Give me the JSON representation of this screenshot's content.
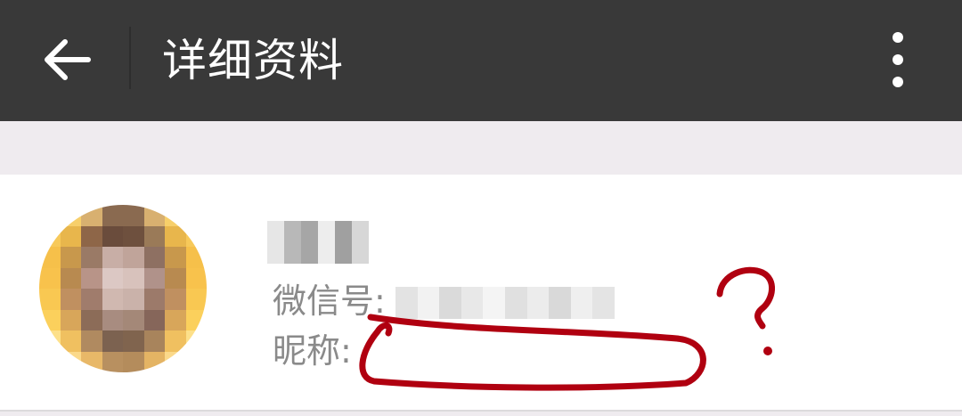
{
  "appbar": {
    "title": "详细资料",
    "back_icon": "arrow-left-icon",
    "more_icon": "more-vertical-icon",
    "background": "#393939"
  },
  "profile": {
    "wechat_id_label": "微信号:",
    "nickname_label": "昵称:"
  },
  "annotation": {
    "mark": "?",
    "color": "#b00010"
  }
}
